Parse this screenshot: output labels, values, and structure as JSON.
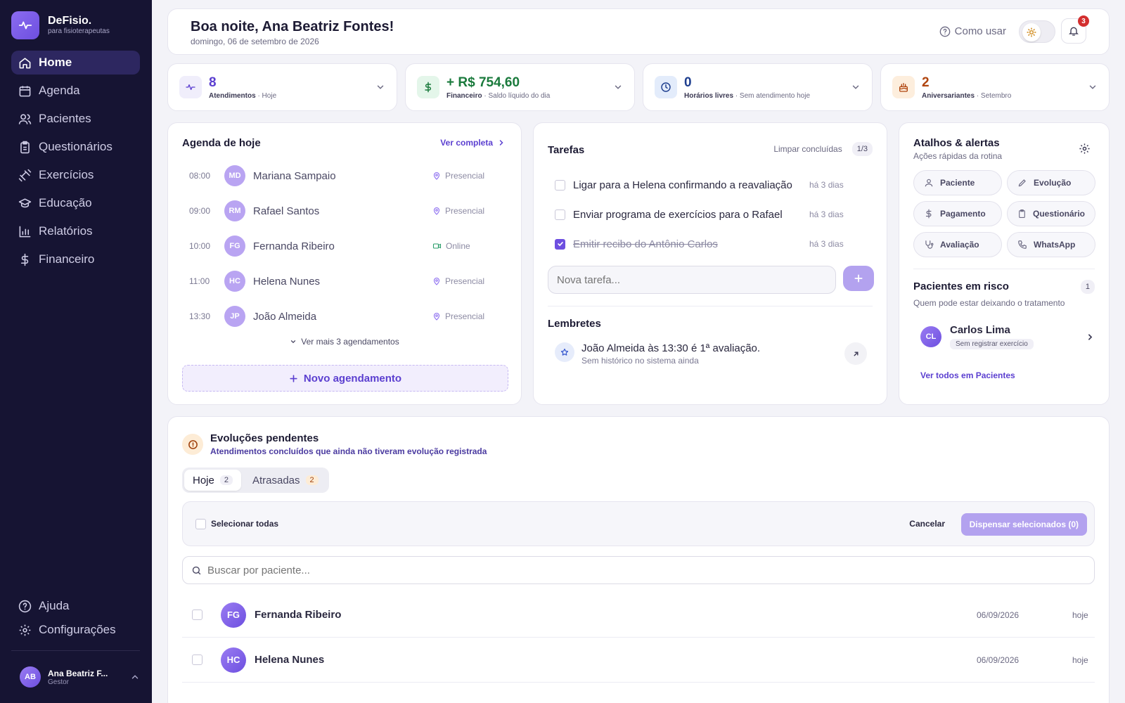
{
  "brand": {
    "name": "DeFisio.",
    "tagline": "para fisioterapeutas"
  },
  "nav": [
    {
      "label": "Home",
      "icon": "home-icon",
      "active": true
    },
    {
      "label": "Agenda",
      "icon": "calendar-icon"
    },
    {
      "label": "Pacientes",
      "icon": "users-icon"
    },
    {
      "label": "Questionários",
      "icon": "clipboard-icon"
    },
    {
      "label": "Exercícios",
      "icon": "dumbbell-icon"
    },
    {
      "label": "Educação",
      "icon": "graduation-cap-icon"
    },
    {
      "label": "Relatórios",
      "icon": "bar-chart-icon"
    },
    {
      "label": "Financeiro",
      "icon": "dollar-icon"
    }
  ],
  "nav_bottom": [
    {
      "label": "Ajuda",
      "icon": "help-icon"
    },
    {
      "label": "Configurações",
      "icon": "gear-icon"
    }
  ],
  "user": {
    "initials": "AB",
    "name": "Ana Beatriz F...",
    "role": "Gestor"
  },
  "header": {
    "greeting": "Boa noite, Ana Beatriz Fontes!",
    "date": "domingo, 06 de setembro de 2026",
    "help_label": "Como usar",
    "notifications": "3"
  },
  "stats": [
    {
      "value": "8",
      "label": "Atendimentos",
      "sub": "· Hoje",
      "icon": "activity-icon",
      "color": "#5b3fd0"
    },
    {
      "value": "+ R$ 754,60",
      "label": "Financeiro",
      "sub": "· Saldo líquido do dia",
      "icon": "dollar-icon",
      "color": "#1a7a3c"
    },
    {
      "value": "0",
      "label": "Horários livres",
      "sub": "· Sem atendimento hoje",
      "icon": "clock-icon",
      "color": "#1f3f8f"
    },
    {
      "value": "2",
      "label": "Aniversariantes",
      "sub": "· Setembro",
      "icon": "cake-icon",
      "color": "#b0450f"
    }
  ],
  "agenda": {
    "title": "Agenda de hoje",
    "see_all": "Ver completa",
    "items": [
      {
        "time": "08:00",
        "initials": "MD",
        "name": "Mariana Sampaio",
        "mode": "Presencial"
      },
      {
        "time": "09:00",
        "initials": "RM",
        "name": "Rafael Santos",
        "mode": "Presencial"
      },
      {
        "time": "10:00",
        "initials": "FG",
        "name": "Fernanda Ribeiro",
        "mode": "Online"
      },
      {
        "time": "11:00",
        "initials": "HC",
        "name": "Helena Nunes",
        "mode": "Presencial"
      },
      {
        "time": "13:30",
        "initials": "JP",
        "name": "João Almeida",
        "mode": "Presencial"
      }
    ],
    "more": "Ver mais 3 agendamentos",
    "new_label": "Novo agendamento"
  },
  "tasks": {
    "title": "Tarefas",
    "clear_label": "Limpar concluídas",
    "count": "1/3",
    "items": [
      {
        "text": "Ligar para a Helena confirmando a reavaliação",
        "time": "há 3 dias",
        "done": false
      },
      {
        "text": "Enviar programa de exercícios para o Rafael",
        "time": "há 3 dias",
        "done": false
      },
      {
        "text": "Emitir recibo do Antônio Carlos",
        "time": "há 3 dias",
        "done": true
      }
    ],
    "placeholder": "Nova tarefa...",
    "reminders_title": "Lembretes",
    "reminder": {
      "text": "João Almeida às 13:30 é 1ª avaliação.",
      "sub": "Sem histórico no sistema ainda"
    }
  },
  "shortcuts": {
    "title": "Atalhos & alertas",
    "subtitle": "Ações rápidas da rotina",
    "items": [
      {
        "label": "Paciente",
        "icon": "user-icon"
      },
      {
        "label": "Evolução",
        "icon": "pen-icon"
      },
      {
        "label": "Pagamento",
        "icon": "dollar-icon"
      },
      {
        "label": "Questionário",
        "icon": "clipboard-icon"
      },
      {
        "label": "Avaliação",
        "icon": "stethoscope-icon"
      },
      {
        "label": "WhatsApp",
        "icon": "phone-icon"
      }
    ],
    "risk": {
      "title": "Pacientes em risco",
      "count": "1",
      "subtitle": "Quem pode estar deixando o tratamento",
      "patient": {
        "initials": "CL",
        "name": "Carlos Lima",
        "tag": "Sem registrar exercício"
      },
      "see_all": "Ver todos em Pacientes"
    }
  },
  "pending": {
    "title": "Evoluções pendentes",
    "subtitle": "Atendimentos concluídos que ainda não tiveram evolução registrada",
    "tabs": [
      {
        "label": "Hoje",
        "count": "2"
      },
      {
        "label": "Atrasadas",
        "count": "2"
      }
    ],
    "select_all": "Selecionar todas",
    "cancel": "Cancelar",
    "dismiss": "Dispensar selecionados (0)",
    "search_placeholder": "Buscar por paciente...",
    "rows": [
      {
        "initials": "FG",
        "name": "Fernanda Ribeiro",
        "date": "06/09/2026",
        "when": "hoje"
      },
      {
        "initials": "HC",
        "name": "Helena Nunes",
        "date": "06/09/2026",
        "when": "hoje"
      }
    ]
  }
}
